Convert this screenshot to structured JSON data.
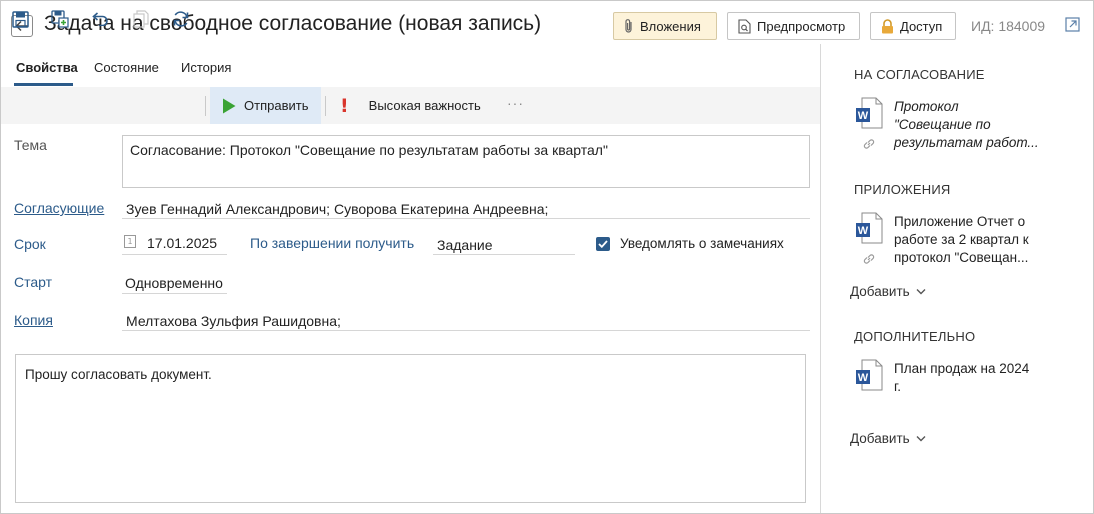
{
  "header": {
    "title": "Задача на свободное согласование (новая запись)",
    "attachments_label": "Вложения",
    "preview_label": "Предпросмотр",
    "access_label": "Доступ",
    "id_label": "ИД: 184009"
  },
  "tabs": [
    {
      "label": "Свойства",
      "active": true
    },
    {
      "label": "Состояние",
      "active": false
    },
    {
      "label": "История",
      "active": false
    }
  ],
  "toolbar": {
    "send_label": "Отправить",
    "importance_mark": "!",
    "importance_label": "Высокая важность",
    "more": "···"
  },
  "form": {
    "subject_label": "Тема",
    "subject_value": "Согласование: Протокол \"Совещание по результатам работы за квартал\"",
    "approvers_label": "Согласующие",
    "approvers_value": "Зуев Геннадий Александрович; Суворова Екатерина Андреевна;",
    "deadline_label": "Срок",
    "calendar_glyph": "1",
    "deadline_value": "17.01.2025",
    "on_complete_label": "По завершении получить",
    "on_complete_value": "Задание",
    "notify_label": "Уведомлять о замечаниях",
    "notify_checked": true,
    "start_label": "Старт",
    "start_value": "Одновременно",
    "copy_label": "Копия",
    "copy_value": "Мелтахова Зульфия Рашидовна;",
    "body_text": "Прошу согласовать документ."
  },
  "right_panel": {
    "for_approval": {
      "title": "НА СОГЛАСОВАНИЕ",
      "doc_lines": [
        "Протокол",
        "\"Совещание по",
        "результатам работ..."
      ]
    },
    "attachments": {
      "title": "ПРИЛОЖЕНИЯ",
      "doc_lines": [
        "Приложение Отчет о",
        "работе за 2 квартал к",
        "протокол \"Совещан..."
      ],
      "add_label": "Добавить"
    },
    "additional": {
      "title": "ДОПОЛНИТЕЛЬНО",
      "doc_lines": [
        "План продаж на 2024",
        "г."
      ],
      "add_label": "Добавить"
    }
  },
  "colors": {
    "accent": "#2c5b8a",
    "send_bg": "#dfeaf6",
    "attach_bg": "#fdf3da",
    "importance": "#d9342b",
    "word_icon": "#2b579a",
    "play_green": "#3aa335"
  },
  "icons": [
    "back-arrow-icon",
    "paperclip-icon",
    "preview-icon",
    "lock-icon",
    "open-external-icon",
    "save-icon",
    "save-copy-icon",
    "undo-icon",
    "copy-icon",
    "refresh-icon",
    "play-icon",
    "calendar-icon",
    "checkmark-icon",
    "word-document-icon",
    "link-icon",
    "chevron-down-icon"
  ]
}
